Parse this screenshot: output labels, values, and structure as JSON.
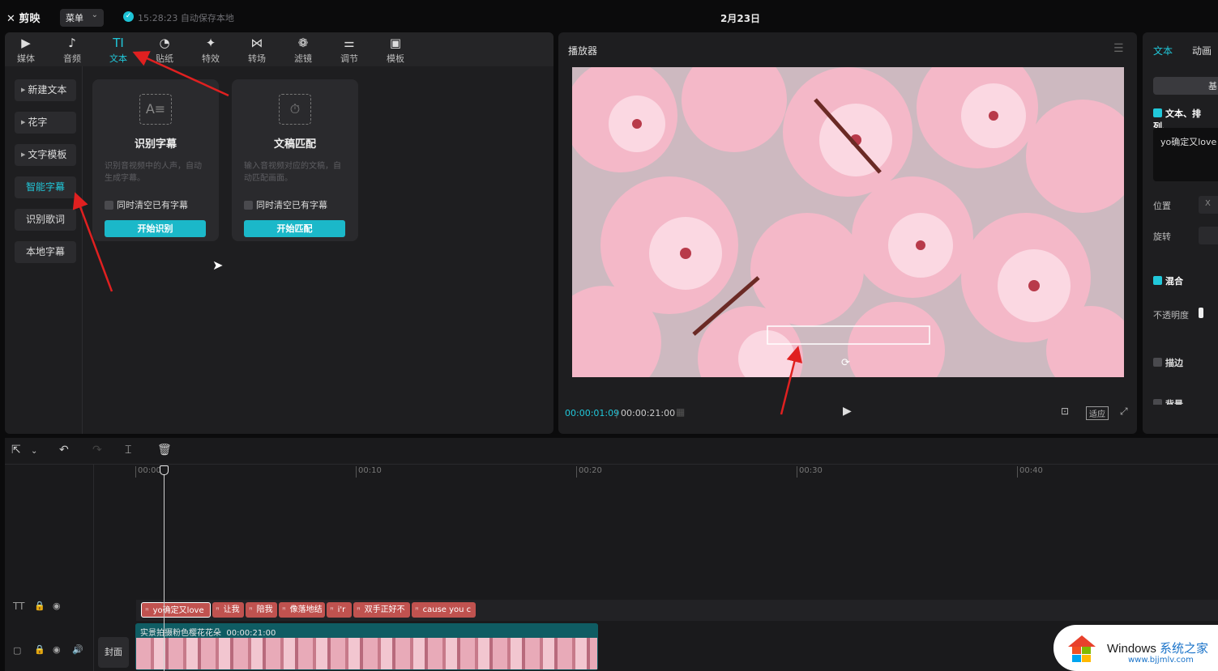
{
  "topbar": {
    "app_name": "剪映",
    "menu_label": "菜单",
    "save_status": "15:28:23 自动保存本地",
    "title": "2月23日"
  },
  "tool_tabs": [
    {
      "label": "媒体",
      "icon": "media-icon"
    },
    {
      "label": "音频",
      "icon": "audio-icon"
    },
    {
      "label": "文本",
      "icon": "text-icon",
      "active": true
    },
    {
      "label": "贴纸",
      "icon": "sticker-icon"
    },
    {
      "label": "特效",
      "icon": "effects-icon"
    },
    {
      "label": "转场",
      "icon": "transition-icon"
    },
    {
      "label": "滤镜",
      "icon": "filter-icon"
    },
    {
      "label": "调节",
      "icon": "adjust-icon"
    },
    {
      "label": "模板",
      "icon": "template-icon"
    }
  ],
  "text_nav": [
    {
      "label": "新建文本"
    },
    {
      "label": "花字"
    },
    {
      "label": "文字模板"
    },
    {
      "label": "智能字幕",
      "active": true
    },
    {
      "label": "识别歌词"
    },
    {
      "label": "本地字幕"
    }
  ],
  "cards": [
    {
      "title": "识别字幕",
      "desc": "识别音视频中的人声，自动生成字幕。",
      "checkbox": "同时清空已有字幕",
      "button": "开始识别"
    },
    {
      "title": "文稿匹配",
      "desc": "输入音视频对应的文稿，自动匹配画面。",
      "checkbox": "同时清空已有字幕",
      "button": "开始匹配"
    }
  ],
  "player": {
    "title": "播放器",
    "current_time": "00:00:01:09",
    "total_time": "00:00:21:00",
    "fit_label": "适应"
  },
  "right_panel": {
    "tabs": [
      "文本",
      "动画"
    ],
    "basic_btn": "基",
    "section_text": "文本、排列、",
    "text_value": "yo确定又love",
    "position_label": "位置",
    "x_label": "X",
    "rotate_label": "旋转",
    "blend_label": "混合",
    "opacity_label": "不透明度",
    "stroke_label": "描边",
    "bg_label": "背景"
  },
  "timeline": {
    "ticks": [
      "00:00",
      "00:10",
      "00:20",
      "00:30",
      "00:40"
    ],
    "text_clips": [
      "yo确定又love",
      "让我",
      "陪我",
      "像落地结",
      "i'r",
      "双手正好不",
      "cause you c"
    ],
    "video_clip_label": "实景拍摄粉色樱花花朵",
    "video_clip_duration": "00:00:21:00",
    "cover_label": "封面"
  },
  "watermark": {
    "brand": "Windows",
    "brand_cn": "系统之家",
    "url": "www.bjjmlv.com"
  },
  "colors": {
    "accent": "#21c8da",
    "clip": "#c0524f",
    "video_track": "#0f5c63"
  }
}
